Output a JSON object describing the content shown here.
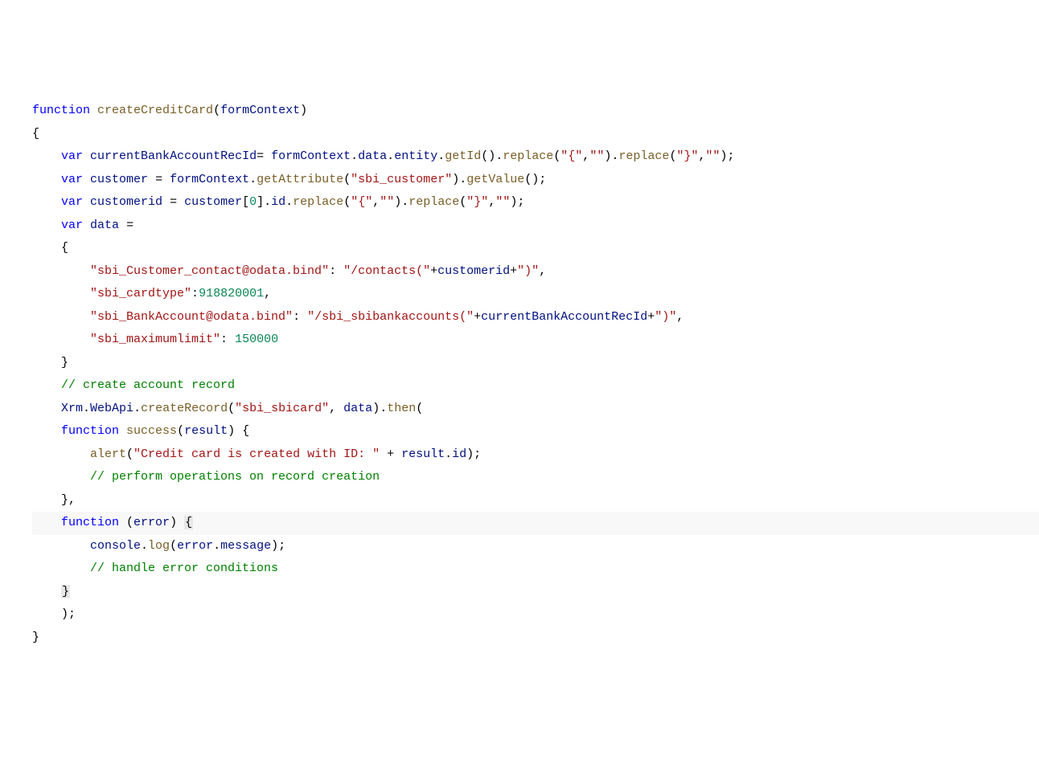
{
  "code": {
    "tokens": [
      [
        [
          "kw",
          "function"
        ],
        [
          "pn",
          " "
        ],
        [
          "fn",
          "createCreditCard"
        ],
        [
          "pn",
          "("
        ],
        [
          "id",
          "formContext"
        ],
        [
          "pn",
          ")"
        ]
      ],
      [
        [
          "pn",
          "{"
        ]
      ],
      [
        [
          "pn",
          "    "
        ],
        [
          "kw",
          "var"
        ],
        [
          "pn",
          " "
        ],
        [
          "id",
          "currentBankAccountRecId"
        ],
        [
          "pn",
          "= "
        ],
        [
          "id",
          "formContext"
        ],
        [
          "pn",
          "."
        ],
        [
          "id",
          "data"
        ],
        [
          "pn",
          "."
        ],
        [
          "id",
          "entity"
        ],
        [
          "pn",
          "."
        ],
        [
          "fn",
          "getId"
        ],
        [
          "pn",
          "()."
        ],
        [
          "fn",
          "replace"
        ],
        [
          "pn",
          "("
        ],
        [
          "str",
          "\"{\""
        ],
        [
          "pn",
          ","
        ],
        [
          "str",
          "\"\""
        ],
        [
          "pn",
          ")."
        ],
        [
          "fn",
          "replace"
        ],
        [
          "pn",
          "("
        ],
        [
          "str",
          "\"}\""
        ],
        [
          "pn",
          ","
        ],
        [
          "str",
          "\"\""
        ],
        [
          "pn",
          ");"
        ]
      ],
      [
        [
          "pn",
          "    "
        ],
        [
          "kw",
          "var"
        ],
        [
          "pn",
          " "
        ],
        [
          "id",
          "customer"
        ],
        [
          "pn",
          " = "
        ],
        [
          "id",
          "formContext"
        ],
        [
          "pn",
          "."
        ],
        [
          "fn",
          "getAttribute"
        ],
        [
          "pn",
          "("
        ],
        [
          "str",
          "\"sbi_customer\""
        ],
        [
          "pn",
          ")."
        ],
        [
          "fn",
          "getValue"
        ],
        [
          "pn",
          "();"
        ]
      ],
      [
        [
          "pn",
          "    "
        ],
        [
          "kw",
          "var"
        ],
        [
          "pn",
          " "
        ],
        [
          "id",
          "customerid"
        ],
        [
          "pn",
          " = "
        ],
        [
          "id",
          "customer"
        ],
        [
          "pn",
          "["
        ],
        [
          "num",
          "0"
        ],
        [
          "pn",
          "]."
        ],
        [
          "id",
          "id"
        ],
        [
          "pn",
          "."
        ],
        [
          "fn",
          "replace"
        ],
        [
          "pn",
          "("
        ],
        [
          "str",
          "\"{\""
        ],
        [
          "pn",
          ","
        ],
        [
          "str",
          "\"\""
        ],
        [
          "pn",
          ")."
        ],
        [
          "fn",
          "replace"
        ],
        [
          "pn",
          "("
        ],
        [
          "str",
          "\"}\""
        ],
        [
          "pn",
          ","
        ],
        [
          "str",
          "\"\""
        ],
        [
          "pn",
          ");"
        ]
      ],
      [
        [
          "pn",
          ""
        ]
      ],
      [
        [
          "pn",
          "    "
        ],
        [
          "kw",
          "var"
        ],
        [
          "pn",
          " "
        ],
        [
          "id",
          "data"
        ],
        [
          "pn",
          " ="
        ]
      ],
      [
        [
          "pn",
          "    {"
        ]
      ],
      [
        [
          "pn",
          "        "
        ],
        [
          "str",
          "\"sbi_Customer_contact@odata.bind\""
        ],
        [
          "pn",
          ": "
        ],
        [
          "str",
          "\"/contacts(\""
        ],
        [
          "pn",
          "+"
        ],
        [
          "id",
          "customerid"
        ],
        [
          "pn",
          "+"
        ],
        [
          "str",
          "\")\""
        ],
        [
          "pn",
          ","
        ]
      ],
      [
        [
          "pn",
          "        "
        ],
        [
          "str",
          "\"sbi_cardtype\""
        ],
        [
          "pn",
          ":"
        ],
        [
          "num",
          "918820001"
        ],
        [
          "pn",
          ","
        ]
      ],
      [
        [
          "pn",
          "        "
        ],
        [
          "str",
          "\"sbi_BankAccount@odata.bind\""
        ],
        [
          "pn",
          ": "
        ],
        [
          "str",
          "\"/sbi_sbibankaccounts(\""
        ],
        [
          "pn",
          "+"
        ],
        [
          "id",
          "currentBankAccountRecId"
        ],
        [
          "pn",
          "+"
        ],
        [
          "str",
          "\")\""
        ],
        [
          "pn",
          ","
        ]
      ],
      [
        [
          "pn",
          "        "
        ],
        [
          "str",
          "\"sbi_maximumlimit\""
        ],
        [
          "pn",
          ": "
        ],
        [
          "num",
          "150000"
        ]
      ],
      [
        [
          "pn",
          "    }"
        ]
      ],
      [
        [
          "pn",
          ""
        ]
      ],
      [
        [
          "pn",
          "    "
        ],
        [
          "cmt",
          "// create account record"
        ]
      ],
      [
        [
          "pn",
          "    "
        ],
        [
          "id",
          "Xrm"
        ],
        [
          "pn",
          "."
        ],
        [
          "id",
          "WebApi"
        ],
        [
          "pn",
          "."
        ],
        [
          "fn",
          "createRecord"
        ],
        [
          "pn",
          "("
        ],
        [
          "str",
          "\"sbi_sbicard\""
        ],
        [
          "pn",
          ", "
        ],
        [
          "id",
          "data"
        ],
        [
          "pn",
          ")."
        ],
        [
          "fn",
          "then"
        ],
        [
          "pn",
          "("
        ]
      ],
      [
        [
          "pn",
          "    "
        ],
        [
          "kw",
          "function"
        ],
        [
          "pn",
          " "
        ],
        [
          "fn",
          "success"
        ],
        [
          "pn",
          "("
        ],
        [
          "id",
          "result"
        ],
        [
          "pn",
          ") {"
        ]
      ],
      [
        [
          "pn",
          "        "
        ],
        [
          "fn",
          "alert"
        ],
        [
          "pn",
          "("
        ],
        [
          "str",
          "\"Credit card is created with ID: \""
        ],
        [
          "pn",
          " + "
        ],
        [
          "id",
          "result"
        ],
        [
          "pn",
          "."
        ],
        [
          "id",
          "id"
        ],
        [
          "pn",
          ");"
        ]
      ],
      [
        [
          "pn",
          "        "
        ],
        [
          "cmt",
          "// perform operations on record creation"
        ]
      ],
      [
        [
          "pn",
          "    },"
        ]
      ],
      [
        [
          "pn",
          "    "
        ],
        [
          "kw",
          "function"
        ],
        [
          "pn",
          " ("
        ],
        [
          "id",
          "error"
        ],
        [
          "pn",
          ") "
        ],
        [
          "box",
          "{"
        ]
      ],
      [
        [
          "pn",
          "        "
        ],
        [
          "id",
          "console"
        ],
        [
          "pn",
          "."
        ],
        [
          "fn",
          "log"
        ],
        [
          "pn",
          "("
        ],
        [
          "id",
          "error"
        ],
        [
          "pn",
          "."
        ],
        [
          "id",
          "message"
        ],
        [
          "pn",
          ");"
        ]
      ],
      [
        [
          "pn",
          "        "
        ],
        [
          "cmt",
          "// handle error conditions"
        ]
      ],
      [
        [
          "pn",
          "    "
        ],
        [
          "box",
          "}"
        ]
      ],
      [
        [
          "pn",
          "    );"
        ]
      ],
      [
        [
          "pn",
          "}"
        ]
      ]
    ],
    "highlighted_line": 20
  }
}
